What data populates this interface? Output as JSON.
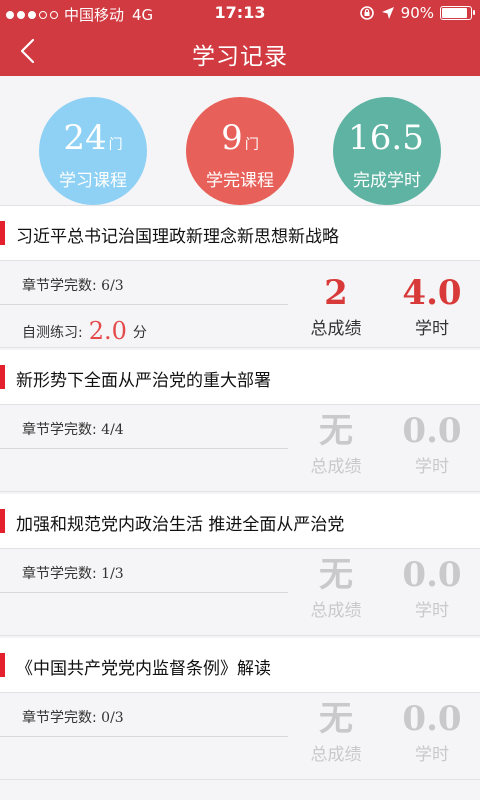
{
  "status_bar": {
    "carrier": "中国移动",
    "network": "4G",
    "time": "17:13",
    "battery": "90%",
    "battery_level": 0.9
  },
  "navbar": {
    "title": "学习记录"
  },
  "stats": [
    {
      "value": "24",
      "unit": "门",
      "label": "学习课程",
      "color": "#8fd1f4"
    },
    {
      "value": "9",
      "unit": "门",
      "label": "学完课程",
      "color": "#e8605a"
    },
    {
      "value": "16.5",
      "unit": "",
      "label": "完成学时",
      "color": "#5fb3a3"
    }
  ],
  "courses": [
    {
      "title": "习近平总书记治国理政新理念新思想新战略",
      "chapter_label": "章节学完数: ",
      "chapter_value": "6/3",
      "selftest_label": "自测练习:",
      "selftest_value": "2.0",
      "selftest_unit": "分",
      "total_score": "2",
      "total_label": "总成绩",
      "hours": "4.0",
      "hours_label": "学时"
    },
    {
      "title": "新形势下全面从严治党的重大部署",
      "chapter_label": "章节学完数: ",
      "chapter_value": "4/4",
      "total_score": "无",
      "total_label": "总成绩",
      "hours": "0.0",
      "hours_label": "学时"
    },
    {
      "title": "加强和规范党内政治生活 推进全面从严治党",
      "chapter_label": "章节学完数: ",
      "chapter_value": "1/3",
      "total_score": "无",
      "total_label": "总成绩",
      "hours": "0.0",
      "hours_label": "学时"
    },
    {
      "title": "《中国共产党党内监督条例》解读",
      "chapter_label": "章节学完数: ",
      "chapter_value": "0/3",
      "total_score": "无",
      "total_label": "总成绩",
      "hours": "0.0",
      "hours_label": "学时"
    }
  ]
}
